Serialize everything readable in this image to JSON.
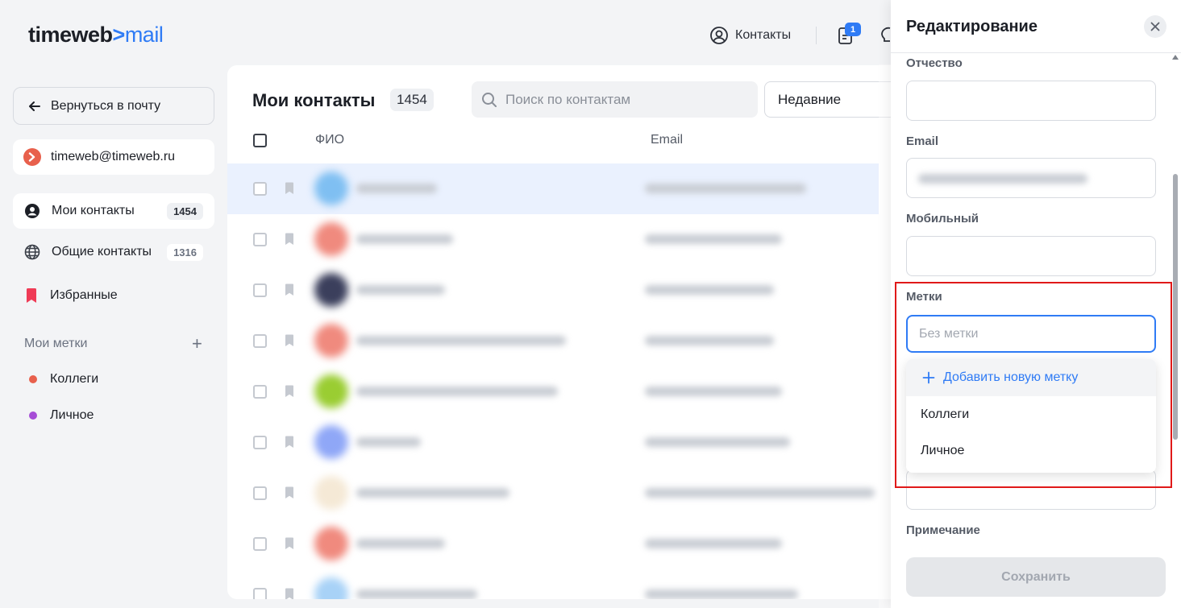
{
  "header": {
    "logo_brand": "timeweb",
    "logo_arrow": ">",
    "logo_product": "mail",
    "contacts_label": "Контакты",
    "notes_badge": "1"
  },
  "sidebar": {
    "back_label": "Вернуться в почту",
    "account_email": "timeweb@timeweb.ru",
    "nav": [
      {
        "label": "Мои контакты",
        "count": "1454"
      },
      {
        "label": "Общие контакты",
        "count": "1316"
      },
      {
        "label": "Избранные"
      }
    ],
    "labels_title": "Мои метки",
    "labels_add": "+",
    "labels": [
      {
        "label": "Коллеги",
        "color": "#e8604c"
      },
      {
        "label": "Личное",
        "color": "#a64dd6"
      }
    ]
  },
  "main": {
    "title": "Мои контакты",
    "count": "1454",
    "search_placeholder": "Поиск по контактам",
    "sort_value": "Недавние",
    "columns": {
      "name": "ФИО",
      "email": "Email"
    },
    "rows": [
      {
        "avatar_color": "#7fbff2"
      },
      {
        "avatar_color": "#f08a7e"
      },
      {
        "avatar_color": "#3b3f5c"
      },
      {
        "avatar_color": "#f08a7e"
      },
      {
        "avatar_color": "#9acd32"
      },
      {
        "avatar_color": "#8fa7f7"
      },
      {
        "avatar_color": "#f5e9d6"
      },
      {
        "avatar_color": "#f08a7e"
      },
      {
        "avatar_color": "#a8d2f7"
      }
    ]
  },
  "panel": {
    "title": "Редактирование",
    "fields": {
      "patronymic": "Отчество",
      "email": "Email",
      "mobile": "Мобильный",
      "tags": "Метки",
      "note": "Примечание"
    },
    "tags_placeholder": "Без метки",
    "dropdown": {
      "add_label": "Добавить новую метку",
      "items": [
        "Коллеги",
        "Личное"
      ]
    },
    "save_label": "Сохранить"
  },
  "colors": {
    "accent": "#2f7bf5",
    "highlight_box": "#e01919",
    "favorites": "#ef3b56"
  }
}
